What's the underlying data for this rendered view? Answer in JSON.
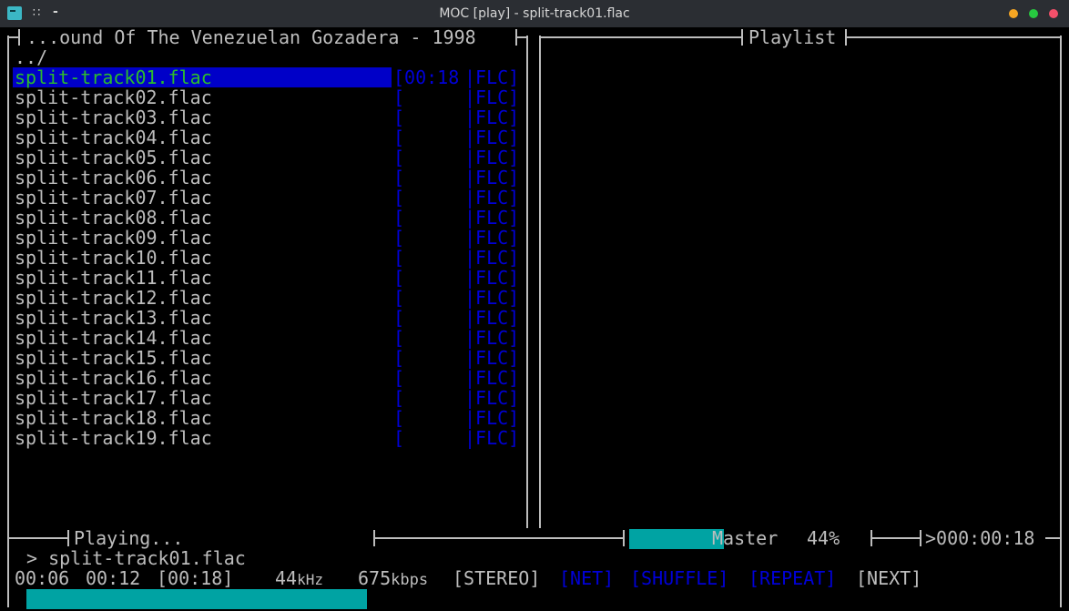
{
  "window": {
    "title": "MOC [play] - split-track01.flac"
  },
  "browser": {
    "title": "...ound Of The Venezuelan Gozadera - 1998",
    "parent_dir": "../",
    "files": [
      {
        "name": "split-track01.flac",
        "time": "[00:18",
        "format": "|FLC]",
        "active": true
      },
      {
        "name": "split-track02.flac",
        "time": "[",
        "format": "|FLC]"
      },
      {
        "name": "split-track03.flac",
        "time": "[",
        "format": "|FLC]"
      },
      {
        "name": "split-track04.flac",
        "time": "[",
        "format": "|FLC]"
      },
      {
        "name": "split-track05.flac",
        "time": "[",
        "format": "|FLC]"
      },
      {
        "name": "split-track06.flac",
        "time": "[",
        "format": "|FLC]"
      },
      {
        "name": "split-track07.flac",
        "time": "[",
        "format": "|FLC]"
      },
      {
        "name": "split-track08.flac",
        "time": "[",
        "format": "|FLC]"
      },
      {
        "name": "split-track09.flac",
        "time": "[",
        "format": "|FLC]"
      },
      {
        "name": "split-track10.flac",
        "time": "[",
        "format": "|FLC]"
      },
      {
        "name": "split-track11.flac",
        "time": "[",
        "format": "|FLC]"
      },
      {
        "name": "split-track12.flac",
        "time": "[",
        "format": "|FLC]"
      },
      {
        "name": "split-track13.flac",
        "time": "[",
        "format": "|FLC]"
      },
      {
        "name": "split-track14.flac",
        "time": "[",
        "format": "|FLC]"
      },
      {
        "name": "split-track15.flac",
        "time": "[",
        "format": "|FLC]"
      },
      {
        "name": "split-track16.flac",
        "time": "[",
        "format": "|FLC]"
      },
      {
        "name": "split-track17.flac",
        "time": "[",
        "format": "|FLC]"
      },
      {
        "name": "split-track18.flac",
        "time": "[",
        "format": "|FLC]"
      },
      {
        "name": "split-track19.flac",
        "time": "[",
        "format": "|FLC]"
      }
    ]
  },
  "playlist": {
    "title": "Playlist"
  },
  "status": {
    "state": "Playing...",
    "mixer_label": "Master",
    "volume_percent": 44,
    "volume_text": "44%",
    "total_time": ">000:00:18",
    "current_track": "> split-track01.flac",
    "elapsed": "00:06",
    "remaining": "00:12",
    "duration": "[00:18]",
    "rate_value": "44",
    "rate_unit": "kHz",
    "bitrate_value": "675",
    "bitrate_unit": "kbps",
    "flags": {
      "stereo": "[STEREO]",
      "net": "[NET]",
      "shuffle": "[SHUFFLE]",
      "repeat": "[REPEAT]",
      "next": "[NEXT]"
    },
    "progress_fraction": 0.33
  },
  "colors": {
    "accent_cyan": "#00a3a3",
    "selection_blue": "#0000c8",
    "active_green": "#2cbd2c",
    "inactive_blue": "#0000d8"
  }
}
